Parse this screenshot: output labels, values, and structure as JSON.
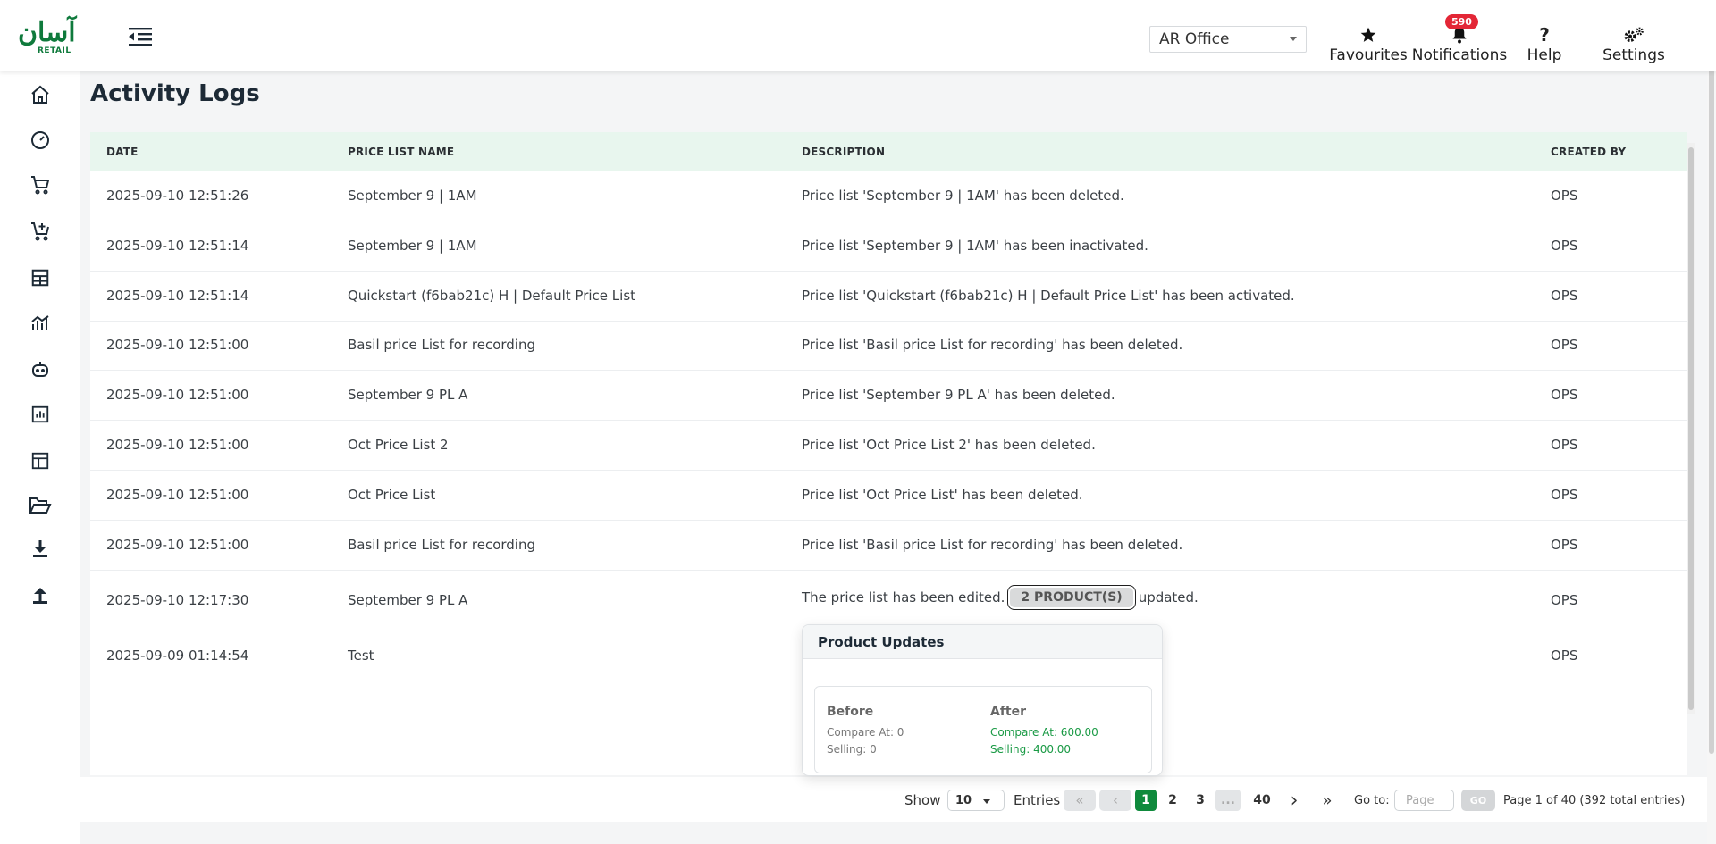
{
  "header": {
    "logo_text_ar": "آسان",
    "logo_text_en": "RETAIL",
    "office": "AR Office",
    "favourites": "Favourites",
    "notifications": "Notifications",
    "notifications_count": "590",
    "help": "Help",
    "settings": "Settings",
    "help_glyph": "?"
  },
  "sidebar": {
    "items": [
      "home-icon",
      "dashboard-gauge-icon",
      "cart-icon",
      "cart-add-icon",
      "inventory-icon",
      "analytics-icon",
      "bot-icon",
      "report-chart-icon",
      "layout-icon",
      "folder-open-icon",
      "download-icon",
      "upload-icon"
    ]
  },
  "page": {
    "title": "Activity Logs"
  },
  "table": {
    "headers": {
      "date": "DATE",
      "name": "PRICE LIST NAME",
      "desc": "DESCRIPTION",
      "by": "CREATED BY"
    },
    "rows": [
      {
        "date": "2025-09-10 12:51:26",
        "name": "September 9 | 1AM",
        "desc": "Price list 'September 9 | 1AM' has been deleted.",
        "by": "OPS"
      },
      {
        "date": "2025-09-10 12:51:14",
        "name": "September 9 | 1AM",
        "desc": "Price list 'September 9 | 1AM' has been inactivated.",
        "by": "OPS"
      },
      {
        "date": "2025-09-10 12:51:14",
        "name": "Quickstart (f6bab21c) H | Default Price List",
        "desc": "Price list 'Quickstart (f6bab21c) H | Default Price List' has been activated.",
        "by": "OPS"
      },
      {
        "date": "2025-09-10 12:51:00",
        "name": "Basil price List for recording",
        "desc": "Price list 'Basil price List for recording' has been deleted.",
        "by": "OPS"
      },
      {
        "date": "2025-09-10 12:51:00",
        "name": "September 9 PL A",
        "desc": "Price list 'September 9 PL A' has been deleted.",
        "by": "OPS"
      },
      {
        "date": "2025-09-10 12:51:00",
        "name": "Oct Price List 2",
        "desc": "Price list 'Oct Price List 2' has been deleted.",
        "by": "OPS"
      },
      {
        "date": "2025-09-10 12:51:00",
        "name": "Oct Price List",
        "desc": "Price list 'Oct Price List' has been deleted.",
        "by": "OPS"
      },
      {
        "date": "2025-09-10 12:51:00",
        "name": "Basil price List for recording",
        "desc": "Price list 'Basil price List for recording' has been deleted.",
        "by": "OPS"
      },
      {
        "date": "2025-09-10 12:17:30",
        "name": "September 9 PL A",
        "desc_pre": "The price list has been edited.",
        "desc_pill": "2 PRODUCT(S)",
        "desc_post": "updated.",
        "by": "OPS"
      },
      {
        "date": "2025-09-09 01:14:54",
        "name": "Test",
        "desc": "",
        "by": "OPS"
      }
    ]
  },
  "popover": {
    "title": "Product Updates",
    "before_label": "Before",
    "after_label": "After",
    "before_compare": "Compare At: 0",
    "before_selling": "Selling: 0",
    "after_compare": "Compare At: 600.00",
    "after_selling": "Selling: 400.00"
  },
  "pager": {
    "show": "Show",
    "page_size": "10",
    "entries": "Entries",
    "pages": [
      "1",
      "2",
      "3",
      "...",
      "40"
    ],
    "current": "1",
    "goto": "Go to:",
    "goto_placeholder": "Page",
    "go": "GO",
    "summary": "Page 1 of 40 (392 total entries)"
  },
  "colors": {
    "brand": "#0f7a3c",
    "badge": "#e32636",
    "header_row": "#e8f6ee",
    "after_value": "#1a9a45"
  }
}
